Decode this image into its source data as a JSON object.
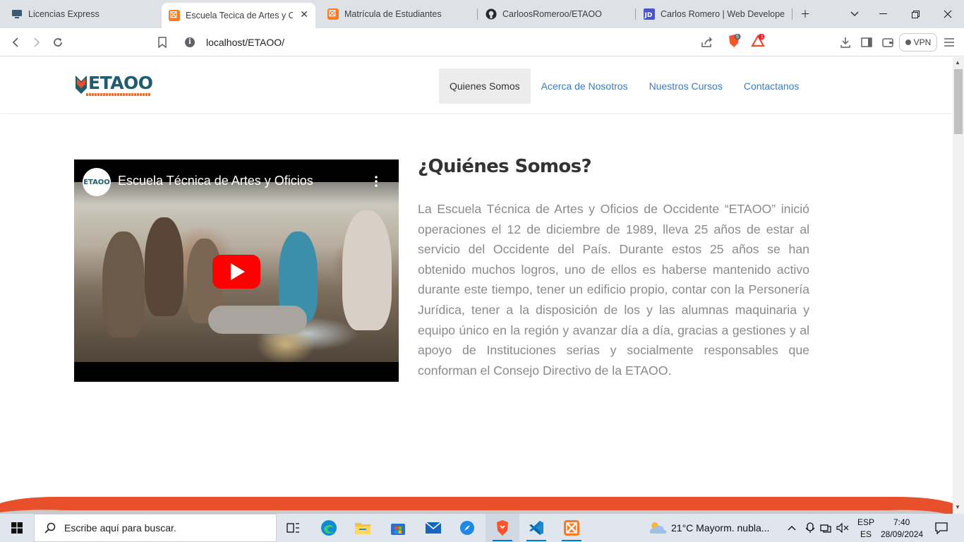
{
  "browser": {
    "tabs": [
      {
        "title": "Licencias Express",
        "favicon": "monitor-icon"
      },
      {
        "title": "Escuela Tecica de Artes y Ofi",
        "favicon": "xampp-icon",
        "active": true
      },
      {
        "title": "Matrícula de Estudiantes",
        "favicon": "xampp-icon"
      },
      {
        "title": "CarloosRomeroo/ETAOO",
        "favicon": "github-icon"
      },
      {
        "title": "Carlos Romero | Web Developer",
        "favicon": "jd-icon"
      }
    ],
    "url": "localhost/ETAOO/",
    "brave_shield_count": "5",
    "rewards_count": "1",
    "vpn_label": "VPN"
  },
  "site": {
    "logo_text": "ETAOO",
    "nav": [
      {
        "label": "Quienes Somos",
        "active": true
      },
      {
        "label": "Acerca de Nosotros"
      },
      {
        "label": "Nuestros Cursos"
      },
      {
        "label": "Contactanos"
      }
    ],
    "video": {
      "title": "Escuela Técnica de Artes y Oficios",
      "channel_badge": "ETAOO"
    },
    "about": {
      "title": "¿Quiénes Somos?",
      "text": "La Escuela Técnica de Artes y Oficios de Occidente “ETAOO” inició operaciones el 12 de diciembre de 1989, lleva 25 años de estar al servicio del Occidente del País. Durante estos 25 años se han obtenido muchos logros, uno de ellos es haberse mantenido activo durante este tiempo, tener un edificio propio, contar con la Personería Jurídica, tener a la disposición de los y las alumnas maquinaria y equipo único en la región y avanzar día a día, gracias a gestiones y al apoyo de Instituciones serias y socialmente responsables que conforman el Consejo Directivo de la ETAOO."
    },
    "accent_color": "#e8502b"
  },
  "taskbar": {
    "search_placeholder": "Escribe aquí para buscar.",
    "weather": "21°C  Mayorm. nubla...",
    "lang_top": "ESP",
    "lang_bottom": "ES",
    "time": "7:40",
    "date": "28/09/2024"
  }
}
